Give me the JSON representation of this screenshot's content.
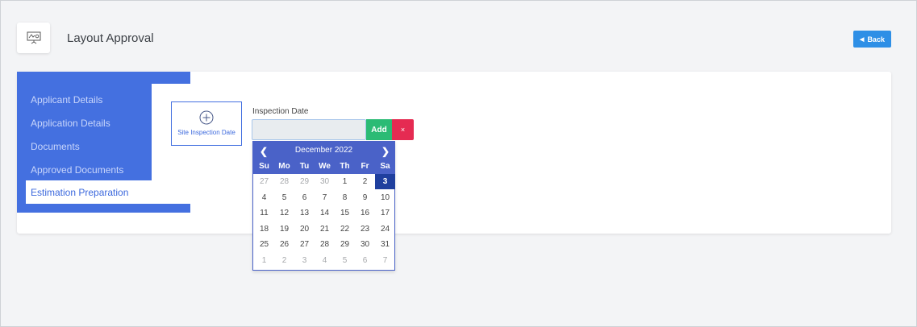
{
  "header": {
    "title": "Layout Approval",
    "logo_icon": "presentation-board-icon",
    "back_label": "Back",
    "back_icon": "chevron-left-icon"
  },
  "sidebar": {
    "items": [
      {
        "label": "Applicant Details"
      },
      {
        "label": "Application Details"
      },
      {
        "label": "Documents"
      },
      {
        "label": "Approved Documents"
      },
      {
        "label": "Estimation Preparation"
      }
    ],
    "active_index": 4
  },
  "site_inspection": {
    "icon": "plus-circle-icon",
    "label": "Site Inspection Date"
  },
  "inspection_form": {
    "label": "Inspection Date",
    "value": "",
    "add_label": "Add",
    "remove_label": "×"
  },
  "calendar": {
    "month_label": "December 2022",
    "prev_icon": "chevron-left-icon",
    "next_icon": "chevron-right-icon",
    "weekdays": [
      "Su",
      "Mo",
      "Tu",
      "We",
      "Th",
      "Fr",
      "Sa"
    ],
    "weeks": [
      [
        "27",
        "28",
        "29",
        "30",
        "1",
        "2",
        "3"
      ],
      [
        "4",
        "5",
        "6",
        "7",
        "8",
        "9",
        "10"
      ],
      [
        "11",
        "12",
        "13",
        "14",
        "15",
        "16",
        "17"
      ],
      [
        "18",
        "19",
        "20",
        "21",
        "22",
        "23",
        "24"
      ],
      [
        "25",
        "26",
        "27",
        "28",
        "29",
        "30",
        "31"
      ],
      [
        "1",
        "2",
        "3",
        "4",
        "5",
        "6",
        "7"
      ]
    ],
    "muted": [
      [
        0,
        0
      ],
      [
        0,
        1
      ],
      [
        0,
        2
      ],
      [
        0,
        3
      ],
      [
        5,
        0
      ],
      [
        5,
        1
      ],
      [
        5,
        2
      ],
      [
        5,
        3
      ],
      [
        5,
        4
      ],
      [
        5,
        5
      ],
      [
        5,
        6
      ]
    ],
    "selected": [
      0,
      6
    ]
  },
  "colors": {
    "accent_blue": "#4470e0",
    "calendar_header": "#4a62c8",
    "selected_day": "#1f3f9e",
    "add_green": "#2bbb75",
    "remove_red": "#e52b52",
    "back_blue": "#2e8fe6"
  }
}
